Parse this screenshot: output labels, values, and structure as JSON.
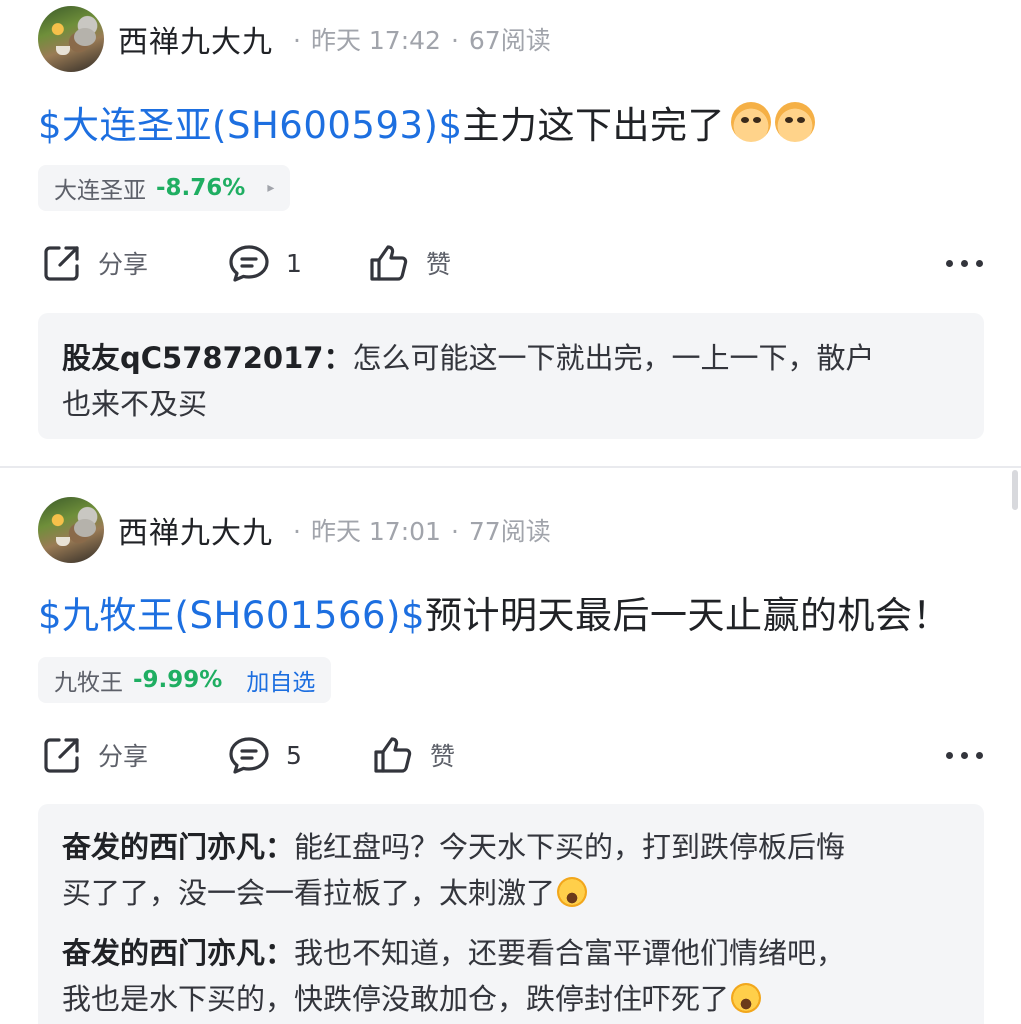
{
  "posts": [
    {
      "author": "西禅九大九",
      "time": "昨天 17:42",
      "reads": "67阅读",
      "cashtag": "$大连圣亚(SH600593)$",
      "text": "主力这下出完了",
      "emoji": [
        "cat-face-emoji",
        "cat-face-emoji"
      ],
      "stock": {
        "name": "大连圣亚",
        "change": "-8.76%",
        "arrow": "▸",
        "action": ""
      },
      "actions": {
        "share": "分享",
        "comments": "1",
        "like": "赞"
      },
      "comments": [
        {
          "user": "股友qC57872017：",
          "line1": "怎么可能这一下就出完，一上一下，散户",
          "line2": "也来不及买",
          "emoji": false
        }
      ]
    },
    {
      "author": "西禅九大九",
      "time": "昨天 17:01",
      "reads": "77阅读",
      "cashtag": "$九牧王(SH601566)$",
      "text": "预计明天最后一天止赢的机会！",
      "emoji": [],
      "stock": {
        "name": "九牧王",
        "change": "-9.99%",
        "arrow": "",
        "action": "加自选"
      },
      "actions": {
        "share": "分享",
        "comments": "5",
        "like": "赞"
      },
      "comments": [
        {
          "user": "奋发的西门亦凡：",
          "line1": "能红盘吗？今天水下买的，打到跌停板后悔",
          "line2": "买了了，没一会一看拉板了，太刺激了",
          "emoji": true
        },
        {
          "user": "奋发的西门亦凡：",
          "line1": "我也不知道，还要看合富平谭他们情绪吧，",
          "line2": "我也是水下买的，快跌停没敢加仓，跌停封住吓死了",
          "emoji": true
        }
      ]
    }
  ],
  "colors": {
    "cashtag": "#1d6fe0",
    "down": "#1fae62",
    "muted": "#a1a4ab",
    "card": "#f4f5f7"
  },
  "icons": {
    "share": "share-icon",
    "comment": "comment-icon",
    "like": "thumbs-up-icon",
    "more": "more-dots-icon"
  }
}
